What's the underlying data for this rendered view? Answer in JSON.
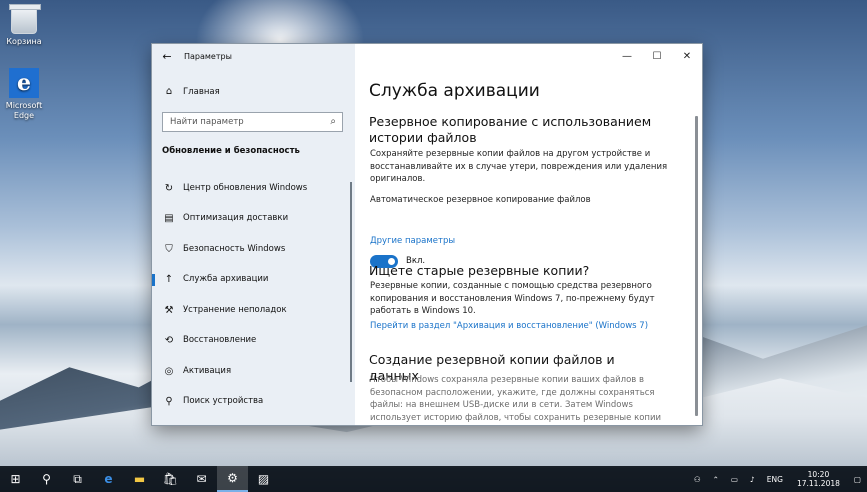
{
  "desktop": {
    "icons": [
      {
        "label": "Корзина"
      },
      {
        "label": "Microsoft Edge"
      }
    ]
  },
  "window": {
    "title": "Параметры",
    "caption_buttons": [
      "minimize-icon",
      "maximize-icon",
      "close-icon"
    ]
  },
  "sidebar": {
    "home_label": "Главная",
    "search_placeholder": "Найти параметр",
    "section_title": "Обновление и безопасность",
    "items": [
      {
        "label": "Центр обновления Windows",
        "icon": "sync-icon"
      },
      {
        "label": "Оптимизация доставки",
        "icon": "delivery-icon"
      },
      {
        "label": "Безопасность Windows",
        "icon": "shield-icon"
      },
      {
        "label": "Служба архивации",
        "icon": "backup-icon",
        "active": true
      },
      {
        "label": "Устранение неполадок",
        "icon": "wrench-icon"
      },
      {
        "label": "Восстановление",
        "icon": "recovery-icon"
      },
      {
        "label": "Активация",
        "icon": "activation-icon"
      },
      {
        "label": "Поиск устройства",
        "icon": "find-device-icon"
      }
    ]
  },
  "main": {
    "title": "Служба архивации",
    "section1": {
      "heading": "Резервное копирование с использованием истории файлов",
      "text": "Сохраняйте резервные копии файлов на другом устройстве и восстанавливайте их в случае утери, повреждения или удаления оригиналов.",
      "auto_label": "Автоматическое резервное копирование файлов",
      "toggle_state": "Вкл.",
      "more_link": "Другие параметры"
    },
    "section2": {
      "heading": "Ищете старые резервные копии?",
      "text": "Резервные копии, созданные с помощью средства резервного копирования и восстановления Windows 7, по-прежнему будут работать в Windows 10.",
      "link": "Перейти в раздел \"Архивация и восстановление\" (Windows 7)"
    },
    "section3": {
      "heading": "Создание резервной копии файлов и данных",
      "text": "Чтобы Windows сохраняла резервные копии ваших файлов в безопасном расположении, укажите, где должны сохраняться файлы: на внешнем USB-диске или в сети. Затем Windows использует историю файлов, чтобы сохранить резервные копии ваших файлов в безопасном расположении."
    }
  },
  "taskbar": {
    "icons": [
      "windows-start-icon",
      "search-icon",
      "task-view-icon",
      "edge-icon",
      "file-explorer-icon",
      "store-icon",
      "mail-icon",
      "settings-icon",
      "photos-icon"
    ],
    "language": "ENG",
    "time": "10:20",
    "date": "17.11.2018"
  }
}
